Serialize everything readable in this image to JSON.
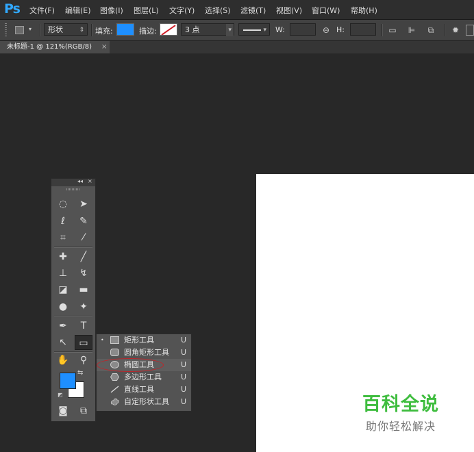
{
  "app": {
    "logo": "Ps"
  },
  "menu": [
    {
      "label": "文件(F)"
    },
    {
      "label": "编辑(E)"
    },
    {
      "label": "图像(I)"
    },
    {
      "label": "图层(L)"
    },
    {
      "label": "文字(Y)"
    },
    {
      "label": "选择(S)"
    },
    {
      "label": "滤镜(T)"
    },
    {
      "label": "视图(V)"
    },
    {
      "label": "窗口(W)"
    },
    {
      "label": "帮助(H)"
    }
  ],
  "options": {
    "mode_value": "形状",
    "fill_label": "填充:",
    "fill_color": "#1e8fff",
    "stroke_label": "描边:",
    "stroke_width_value": "3 点",
    "w_label": "W:",
    "h_label": "H:"
  },
  "document": {
    "tab_title": "未标题-1 @ 121%(RGB/8)",
    "tab_close": "×"
  },
  "toolbox": {
    "collapse": "◂◂",
    "close": "×",
    "foreground_color": "#1e8fff",
    "background_color": "#ffffff"
  },
  "flyout": {
    "items": [
      {
        "label": "矩形工具",
        "shortcut": "U",
        "icon": "rectangle-icon",
        "selected": true
      },
      {
        "label": "圆角矩形工具",
        "shortcut": "U",
        "icon": "rounded-rectangle-icon"
      },
      {
        "label": "椭圆工具",
        "shortcut": "U",
        "icon": "ellipse-icon"
      },
      {
        "label": "多边形工具",
        "shortcut": "U",
        "icon": "polygon-icon"
      },
      {
        "label": "直线工具",
        "shortcut": "U",
        "icon": "line-icon"
      },
      {
        "label": "自定形状工具",
        "shortcut": "U",
        "icon": "custom-shape-icon"
      }
    ],
    "bullet": "•"
  },
  "watermark": {
    "title": "百科全说",
    "subtitle": "助你轻松解决"
  }
}
